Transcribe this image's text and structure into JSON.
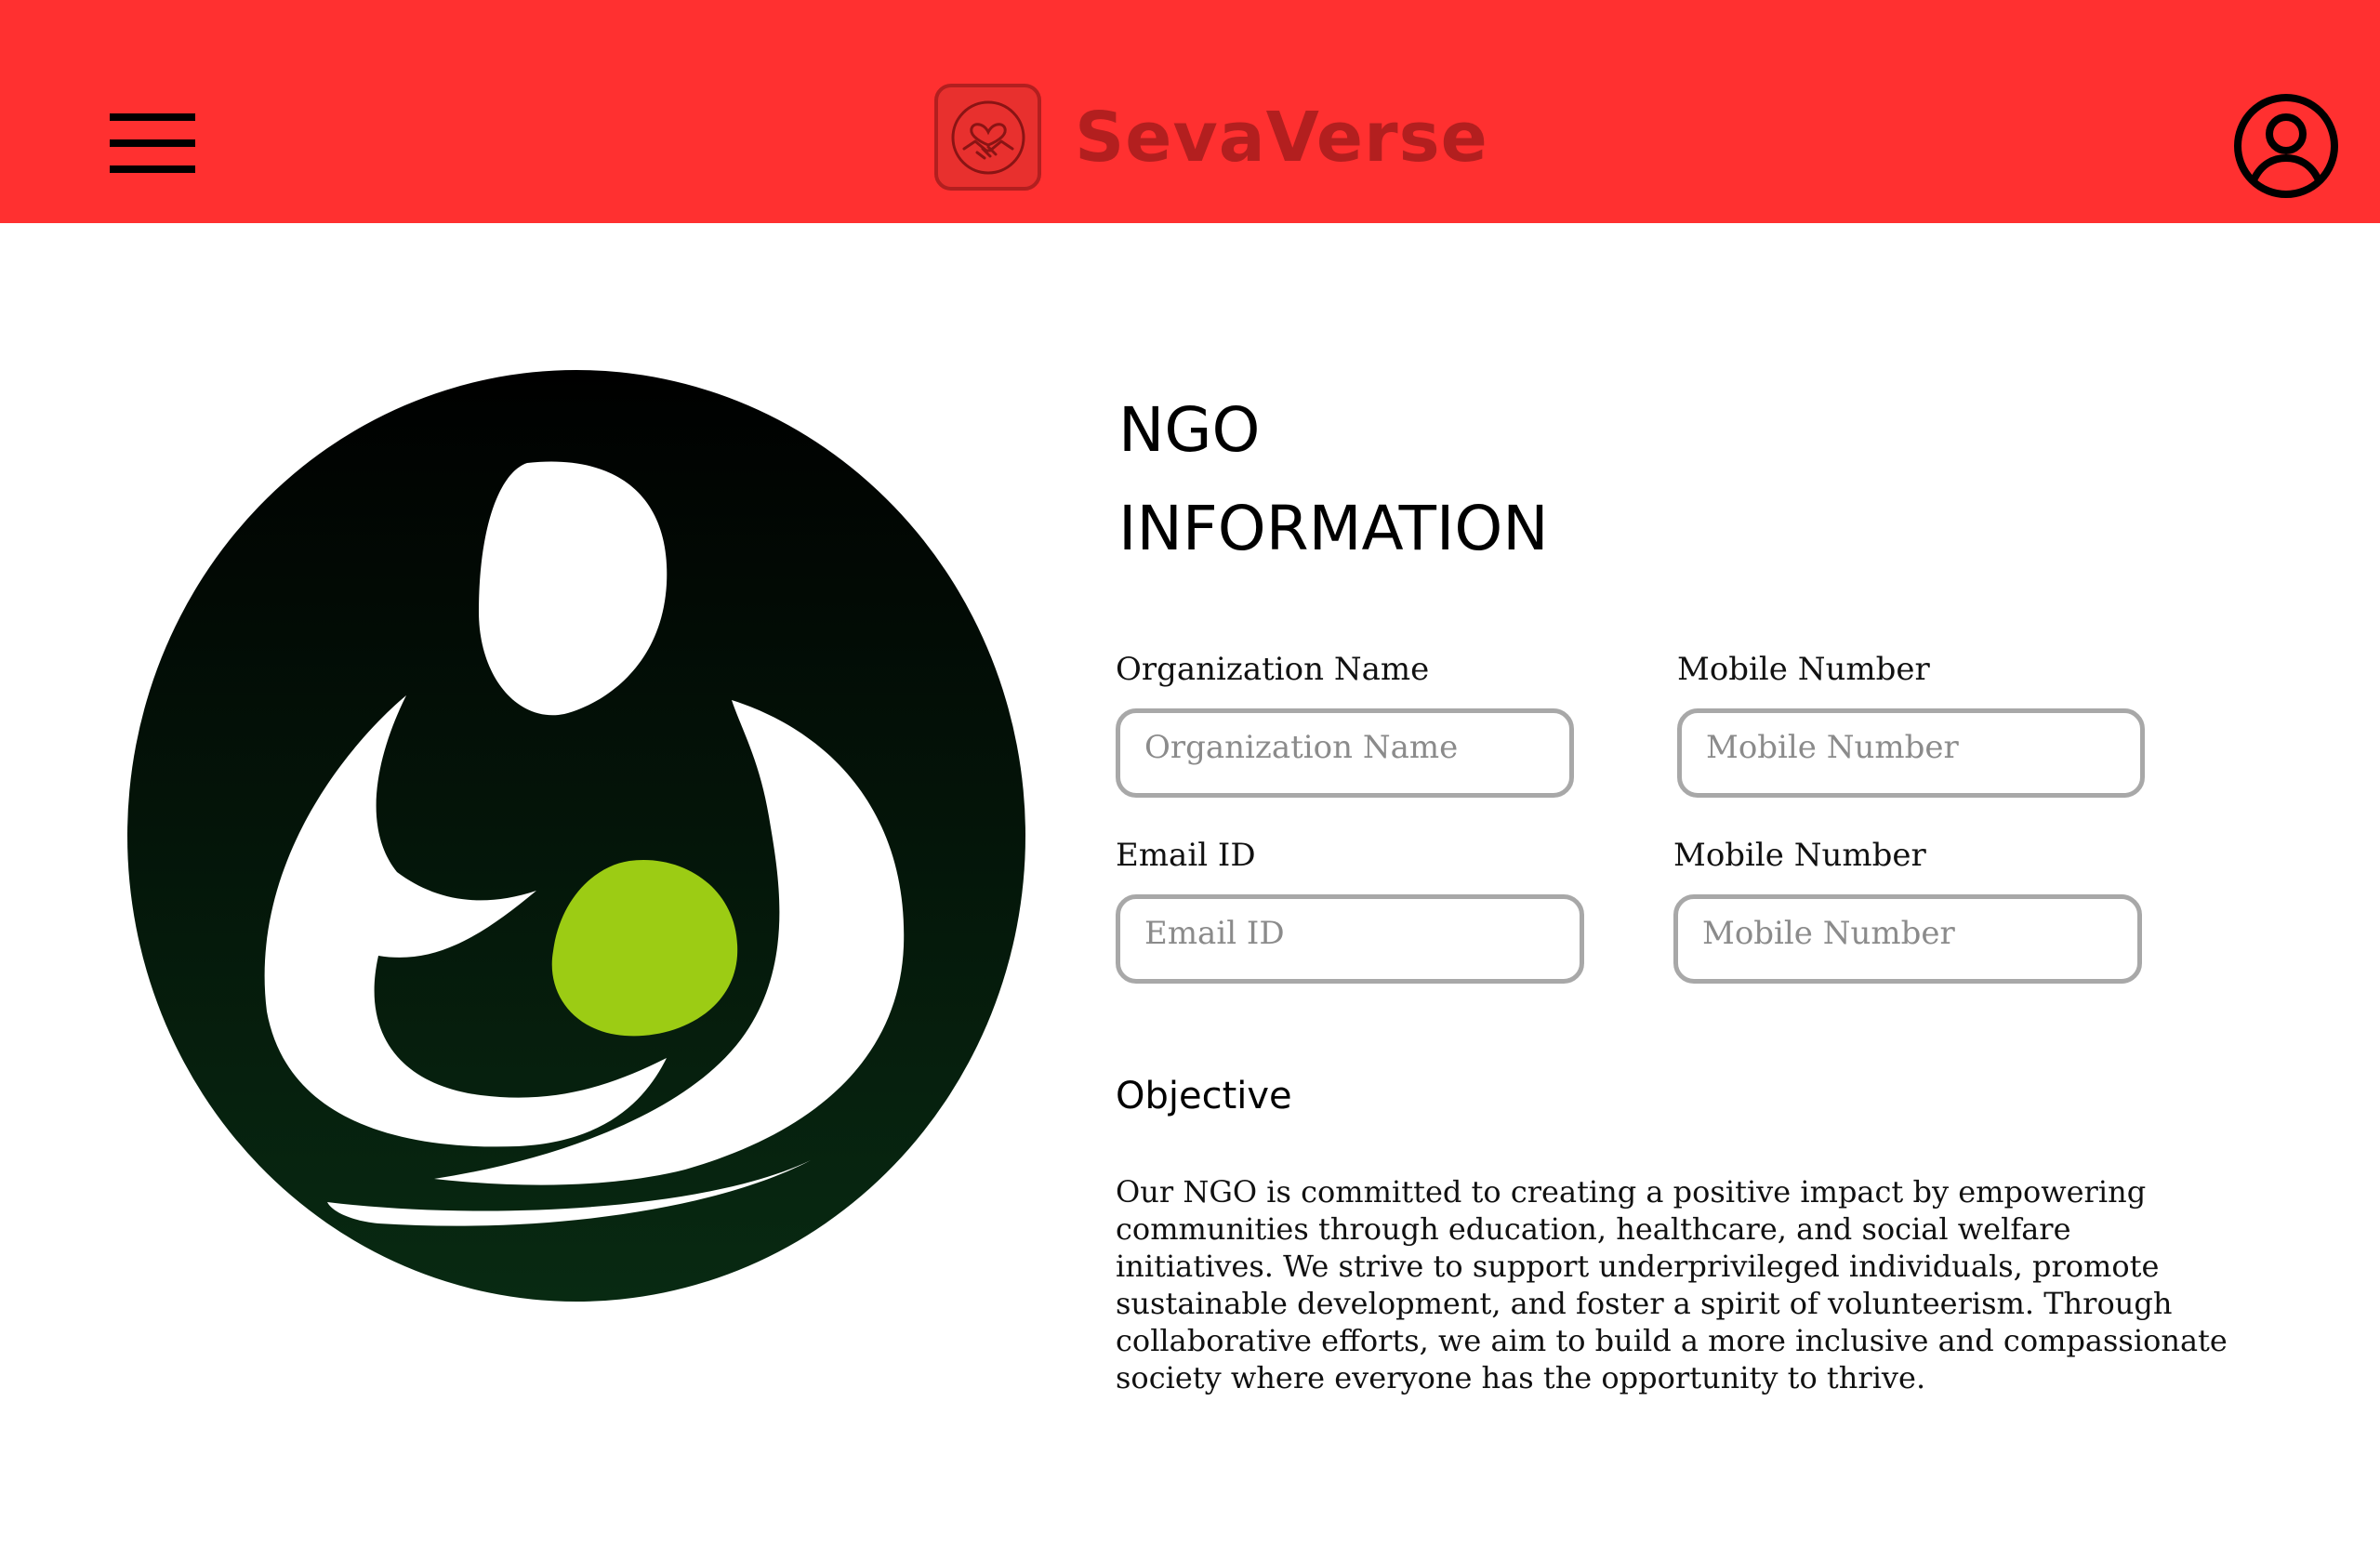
{
  "header": {
    "brand_name": "SevaVerse",
    "background_color": "#ff3030",
    "brand_color": "#b31f1f",
    "menu_icon": "hamburger-menu-icon",
    "profile_icon": "user-profile-icon",
    "logo_icon": "heart-handshake-icon"
  },
  "main": {
    "title_line1": "NGO",
    "title_line2": "INFORMATION",
    "fields": [
      {
        "label": "Organization Name",
        "placeholder": "Organization Name",
        "value": ""
      },
      {
        "label": "Mobile Number",
        "placeholder": "Mobile Number",
        "value": ""
      },
      {
        "label": "Email ID",
        "placeholder": "Email ID",
        "value": ""
      },
      {
        "label": "Mobile Number",
        "placeholder": "Mobile Number",
        "value": ""
      }
    ],
    "objective": {
      "heading": "Objective",
      "text": "Our NGO is committed to creating a positive impact by empowering communities through education, healthcare, and social welfare initiatives. We strive to support underprivileged individuals, promote sustainable development, and foster a spirit of volunteerism. Through collaborative efforts, we aim to build a more inclusive and compassionate society where everyone has the opportunity to thrive."
    },
    "org_logo": {
      "icon": "mother-child-care-logo",
      "colors": {
        "dark": "#07200f",
        "figure": "#ffffff",
        "accent": "#9ccc14"
      }
    }
  }
}
